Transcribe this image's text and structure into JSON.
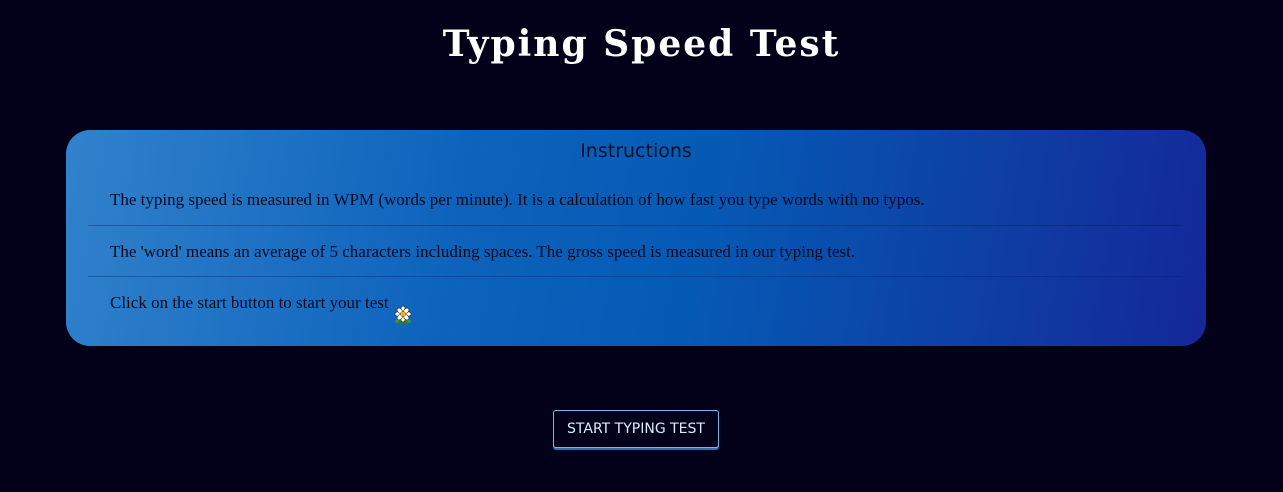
{
  "page": {
    "title": "Typing Speed Test"
  },
  "instructions": {
    "heading": "Instructions",
    "items": [
      "The typing speed is measured in WPM (words per minute). It is a calculation of how fast you type words with no typos.",
      "The 'word' means an average of 5 characters including spaces. The gross speed is measured in our typing test.",
      "Click on the start button to start your test"
    ],
    "item_icon": "flower-icon"
  },
  "actions": {
    "start_label": "START TYPING TEST"
  },
  "colors": {
    "background": "#020119",
    "card_gradient_start": "#3182cc",
    "card_gradient_end": "#14279a",
    "button_border": "#7fb6e6"
  }
}
